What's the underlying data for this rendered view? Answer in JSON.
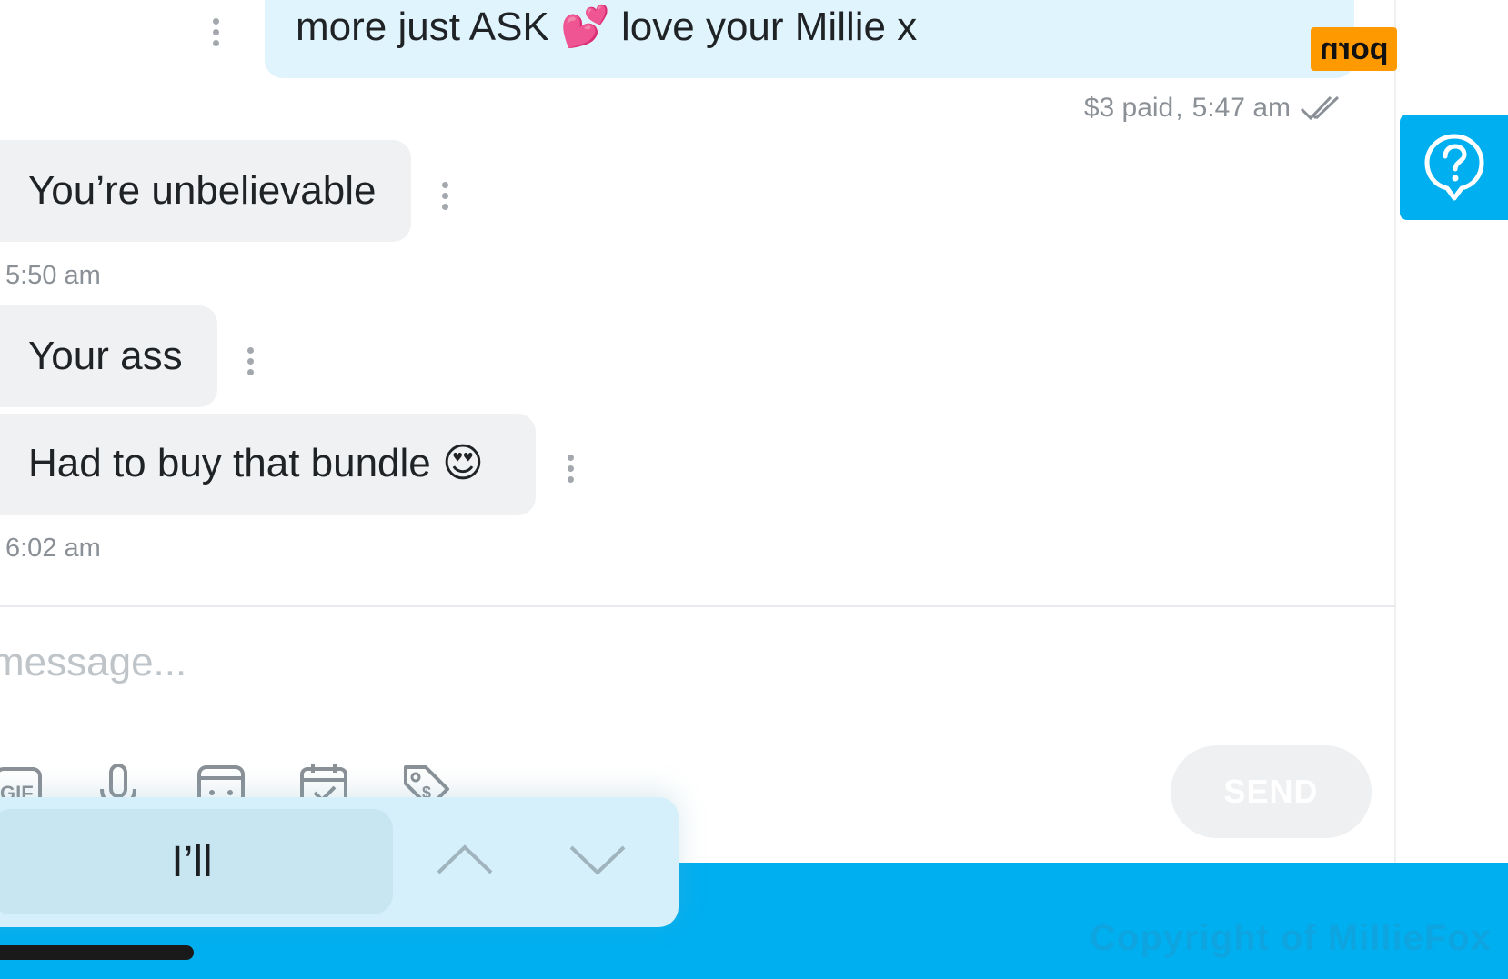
{
  "conversation": {
    "outgoing": {
      "text": "more just ASK 💕 love your Millie x",
      "price": "$3 paid",
      "separator": ",",
      "time": "5:47 am"
    },
    "incoming": [
      {
        "text": "You’re unbelievable",
        "time": "5:50 am"
      },
      {
        "text": "Your ass",
        "time": ""
      },
      {
        "text": "Had to buy that bundle 😍",
        "time": "6:02 am"
      }
    ]
  },
  "composer": {
    "placeholder": "message...",
    "tools": [
      "gif-icon",
      "microphone-icon",
      "vault-icon",
      "calendar-icon",
      "price-tag-icon"
    ],
    "gif_label": "GIF",
    "send_label": "SEND"
  },
  "keyboard": {
    "suggestion": "I’ll"
  },
  "overlay": {
    "watermark": "porn",
    "copyright": "Copyright of MillieFox"
  },
  "colors": {
    "brand_blue": "#00aff0",
    "outgoing_bubble": "#dff4fc",
    "incoming_bubble": "#eff1f3",
    "meta_text": "#8a9096",
    "watermark_bg": "#ff9900"
  }
}
